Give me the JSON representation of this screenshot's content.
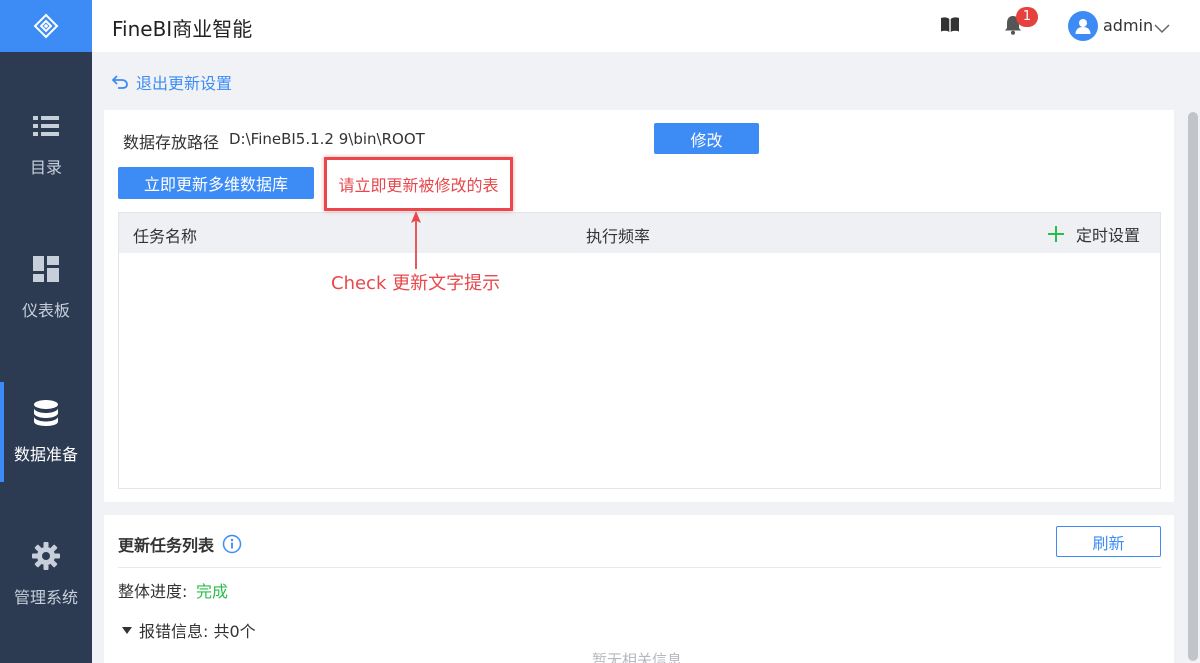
{
  "header": {
    "app_title": "FineBI商业智能",
    "notification_count": "1",
    "username": "admin"
  },
  "sidebar": {
    "items": [
      {
        "label": "目录",
        "icon": "list-icon",
        "active": false
      },
      {
        "label": "仪表板",
        "icon": "dashboard-icon",
        "active": false
      },
      {
        "label": "数据准备",
        "icon": "database-icon",
        "active": true
      },
      {
        "label": "管理系统",
        "icon": "gear-icon",
        "active": false
      }
    ]
  },
  "page": {
    "back_label": "退出更新设置",
    "storage_path_label": "数据存放路径",
    "storage_path_value": "D:\\FineBI5.1.2 9\\bin\\ROOT",
    "modify_label": "修改",
    "update_now_label": "立即更新多维数据库",
    "hint_text": "请立即更新被修改的表",
    "annotation_text": "Check 更新文字提示",
    "table": {
      "col_task_name": "任务名称",
      "col_frequency": "执行频率",
      "timer_setting": "定时设置",
      "rows": []
    }
  },
  "task_list": {
    "title": "更新任务列表",
    "refresh_label": "刷新",
    "progress_label": "整体进度:",
    "progress_value": "完成",
    "error_info": "报错信息: 共0个",
    "empty_text": "暂无相关信息"
  },
  "colors": {
    "primary": "#3d8cf5",
    "sidebar_bg": "#2c3a52",
    "alert_red": "#e8474b",
    "success_green": "#2bbd4c",
    "badge_red": "#e5413d"
  }
}
